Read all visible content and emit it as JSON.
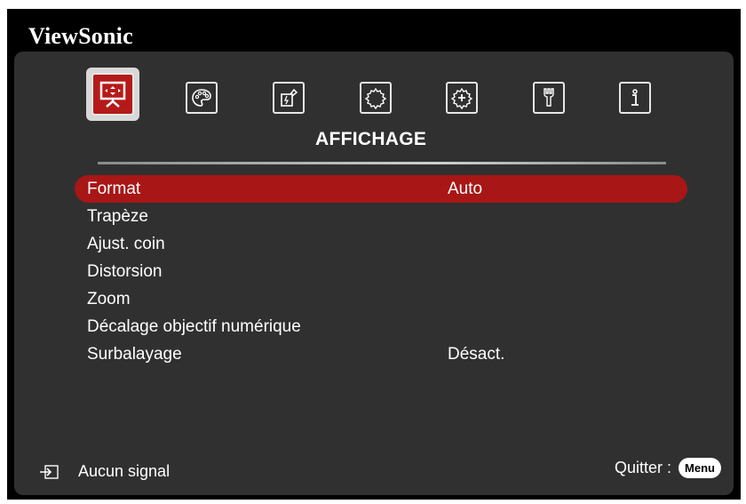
{
  "brand": "ViewSonic",
  "tabs": [
    {
      "name": "display-icon",
      "active": true
    },
    {
      "name": "picture-palette-icon",
      "active": false
    },
    {
      "name": "power-icon",
      "active": false
    },
    {
      "name": "basic-settings-icon",
      "active": false
    },
    {
      "name": "advanced-settings-icon",
      "active": false
    },
    {
      "name": "system-wrench-icon",
      "active": false
    },
    {
      "name": "info-icon",
      "active": false
    }
  ],
  "section_title": "AFFICHAGE",
  "menu": {
    "items": [
      {
        "label": "Format",
        "value": "Auto",
        "selected": true
      },
      {
        "label": "Trapèze",
        "value": ""
      },
      {
        "label": "Ajust. coin",
        "value": ""
      },
      {
        "label": "Distorsion",
        "value": ""
      },
      {
        "label": "Zoom",
        "value": ""
      },
      {
        "label": "Décalage objectif numérique",
        "value": ""
      },
      {
        "label": "Surbalayage",
        "value": "Désact."
      }
    ]
  },
  "footer": {
    "signal": "Aucun signal",
    "exit_label": "Quitter :",
    "menu_key": "Menu"
  },
  "colors": {
    "accent": "#a81616",
    "panel": "#303030",
    "background": "#000000"
  }
}
